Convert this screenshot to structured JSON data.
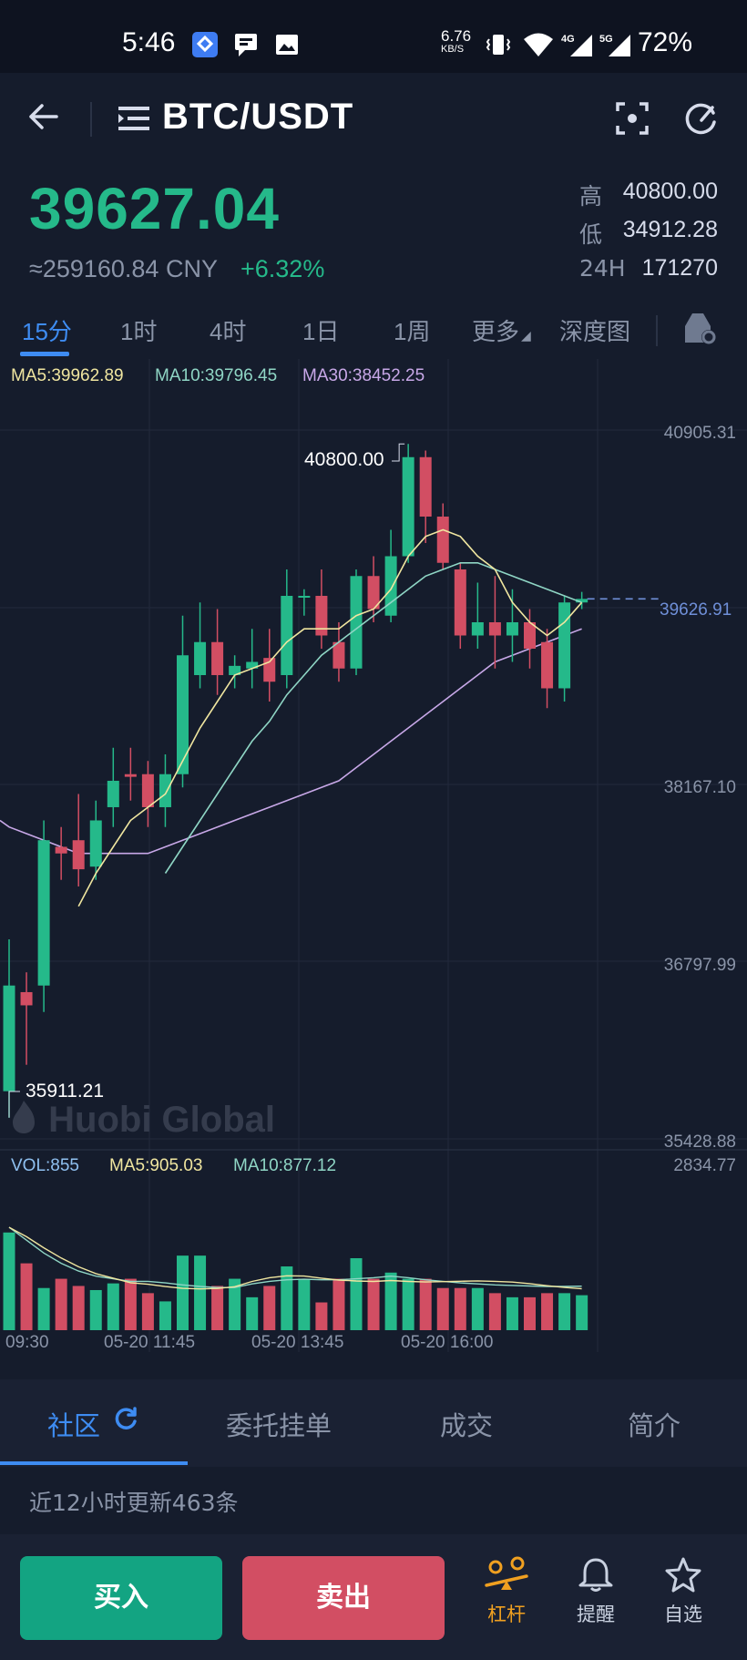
{
  "status_bar": {
    "time": "5:46",
    "net_speed_value": "6.76",
    "net_speed_unit": "KB/S",
    "net_4g": "4G",
    "net_5g": "5G",
    "battery": "72%"
  },
  "nav": {
    "title": "BTC/USDT"
  },
  "ticker": {
    "price": "39627.04",
    "cny": "≈259160.84 CNY",
    "change": "+6.32%",
    "high_label": "高",
    "high": "40800.00",
    "low_label": "低",
    "low": "34912.28",
    "vol_label": "24H",
    "vol": "171270"
  },
  "intervals": {
    "items": [
      "15分",
      "1时",
      "4时",
      "1日",
      "1周",
      "更多",
      "深度图"
    ],
    "active_index": 0
  },
  "chart_legend": {
    "ma5": "MA5:39962.89",
    "ma10": "MA10:39796.45",
    "ma30": "MA30:38452.25",
    "ma5_color": "#f0e6a0",
    "ma10_color": "#8fd6c5",
    "ma30_color": "#c8a8e8"
  },
  "axis": {
    "ticks": [
      "40905.31",
      "38167.10",
      "36797.99",
      "35428.88"
    ],
    "vol_top": "2834.77",
    "current_price": "39626.91",
    "high_mark": "40800.00",
    "low_mark": "35911.21"
  },
  "watermark": "Huobi Global",
  "volume_legend": {
    "vol": "VOL:855",
    "ma5": "MA5:905.03",
    "ma10": "MA10:877.12"
  },
  "time_axis": [
    "09:30",
    "05-20 11:45",
    "05-20 13:45",
    "05-20 16:00"
  ],
  "bottom_tabs": {
    "items": [
      "社区",
      "委托挂单",
      "成交",
      "简介"
    ],
    "active_index": 0,
    "update_text": "近12小时更新463条"
  },
  "actions": {
    "buy": "买入",
    "sell": "卖出",
    "leverage": "杠杆",
    "alert": "提醒",
    "watchlist": "自选"
  },
  "colors": {
    "up": "#25b98a",
    "down": "#d24e63",
    "accent": "#3e8cf2",
    "leverage": "#f0a020"
  },
  "chart_data": {
    "type": "candlestick",
    "ylim": [
      35428.88,
      40905.31
    ],
    "up_color": "#25b98a",
    "down_color": "#d24e63",
    "candles": [
      {
        "o": 35900,
        "c": 36700,
        "h": 37050,
        "l": 35700
      },
      {
        "o": 36650,
        "c": 36550,
        "h": 36800,
        "l": 36100
      },
      {
        "o": 36700,
        "c": 37800,
        "h": 37950,
        "l": 36500
      },
      {
        "o": 37750,
        "c": 37700,
        "h": 37900,
        "l": 37500
      },
      {
        "o": 37800,
        "c": 37580,
        "h": 38150,
        "l": 37450
      },
      {
        "o": 37600,
        "c": 37950,
        "h": 38100,
        "l": 37500
      },
      {
        "o": 38050,
        "c": 38250,
        "h": 38500,
        "l": 37900
      },
      {
        "o": 38300,
        "c": 38280,
        "h": 38500,
        "l": 38100
      },
      {
        "o": 38300,
        "c": 38050,
        "h": 38400,
        "l": 37900
      },
      {
        "o": 38050,
        "c": 38300,
        "h": 38450,
        "l": 37900
      },
      {
        "o": 38300,
        "c": 39200,
        "h": 39500,
        "l": 38200
      },
      {
        "o": 39050,
        "c": 39300,
        "h": 39600,
        "l": 38950
      },
      {
        "o": 39300,
        "c": 39050,
        "h": 39550,
        "l": 38900
      },
      {
        "o": 39050,
        "c": 39120,
        "h": 39200,
        "l": 38950
      },
      {
        "o": 39100,
        "c": 39150,
        "h": 39400,
        "l": 38950
      },
      {
        "o": 39180,
        "c": 39000,
        "h": 39400,
        "l": 38850
      },
      {
        "o": 39050,
        "c": 39650,
        "h": 39850,
        "l": 38950
      },
      {
        "o": 39650,
        "c": 39650,
        "h": 39700,
        "l": 39500
      },
      {
        "o": 39650,
        "c": 39350,
        "h": 39850,
        "l": 39250
      },
      {
        "o": 39300,
        "c": 39100,
        "h": 39450,
        "l": 39000
      },
      {
        "o": 39100,
        "c": 39800,
        "h": 39850,
        "l": 39050
      },
      {
        "o": 39800,
        "c": 39550,
        "h": 39950,
        "l": 39450
      },
      {
        "o": 39500,
        "c": 39950,
        "h": 40150,
        "l": 39450
      },
      {
        "o": 39950,
        "c": 40700,
        "h": 40800,
        "l": 39900
      },
      {
        "o": 40700,
        "c": 40250,
        "h": 40750,
        "l": 40050
      },
      {
        "o": 40250,
        "c": 39900,
        "h": 40350,
        "l": 39850
      },
      {
        "o": 39850,
        "c": 39350,
        "h": 39900,
        "l": 39250
      },
      {
        "o": 39350,
        "c": 39450,
        "h": 39750,
        "l": 39250
      },
      {
        "o": 39450,
        "c": 39350,
        "h": 39800,
        "l": 39100
      },
      {
        "o": 39350,
        "c": 39450,
        "h": 39700,
        "l": 39150
      },
      {
        "o": 39450,
        "c": 39250,
        "h": 39550,
        "l": 39100
      },
      {
        "o": 39300,
        "c": 38950,
        "h": 39400,
        "l": 38800
      },
      {
        "o": 38950,
        "c": 39600,
        "h": 39650,
        "l": 38850
      },
      {
        "o": 39600,
        "c": 39627,
        "h": 39680,
        "l": 39550
      }
    ],
    "ma5": [
      null,
      null,
      null,
      null,
      37300,
      37550,
      37750,
      37950,
      38050,
      38150,
      38400,
      38650,
      38850,
      39050,
      39100,
      39150,
      39300,
      39400,
      39400,
      39400,
      39500,
      39550,
      39700,
      39950,
      40100,
      40150,
      40100,
      39950,
      39850,
      39600,
      39450,
      39350,
      39450,
      39600
    ],
    "ma10": [
      null,
      null,
      null,
      null,
      null,
      null,
      null,
      null,
      null,
      37550,
      37750,
      37950,
      38150,
      38350,
      38550,
      38700,
      38900,
      39050,
      39200,
      39300,
      39400,
      39500,
      39600,
      39700,
      39800,
      39850,
      39900,
      39900,
      39850,
      39800,
      39750,
      39700,
      39650,
      39600
    ],
    "ma30": [
      37900,
      37850,
      37800,
      37750,
      37700,
      37700,
      37700,
      37700,
      37700,
      37750,
      37800,
      37850,
      37900,
      37950,
      38000,
      38050,
      38100,
      38150,
      38200,
      38250,
      38350,
      38450,
      38550,
      38650,
      38750,
      38850,
      38950,
      39050,
      39150,
      39200,
      39250,
      39300,
      39350,
      39400
    ],
    "volume": [
      1900,
      1300,
      820,
      1000,
      860,
      780,
      910,
      1000,
      720,
      560,
      1450,
      1450,
      860,
      1000,
      640,
      860,
      1240,
      1000,
      540,
      1000,
      1400,
      1000,
      1120,
      1000,
      1000,
      820,
      820,
      820,
      720,
      640,
      640,
      720,
      720,
      680
    ],
    "vol_ma": [
      2000,
      1750,
      1500,
      1300,
      1150,
      1050,
      1000,
      950,
      950,
      920,
      880,
      850,
      830,
      830,
      900,
      950,
      980,
      990,
      980,
      980,
      1000,
      1020,
      1050,
      1020,
      980,
      950,
      920,
      900,
      880,
      870,
      860,
      850,
      850,
      855
    ],
    "vol_max": 2834.77
  }
}
